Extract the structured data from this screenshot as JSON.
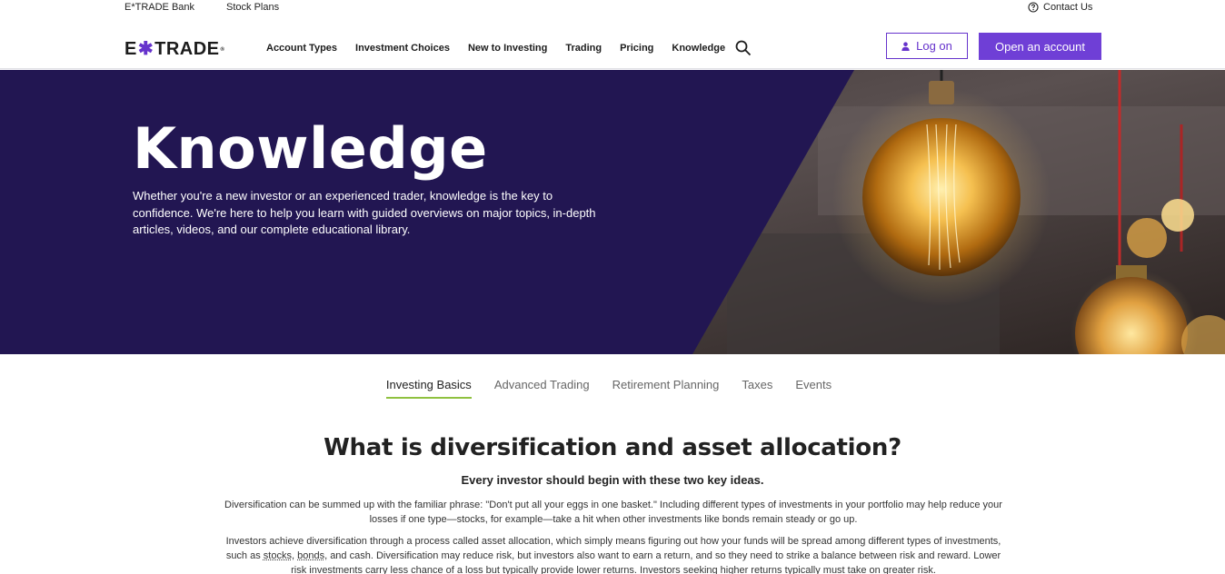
{
  "utility": {
    "bank": "E*TRADE Bank",
    "stock_plans": "Stock Plans",
    "contact": "Contact Us"
  },
  "brand": {
    "logo_pre": "E",
    "logo_star": "✱",
    "logo_post": "TRADE",
    "accent": "#6633cc"
  },
  "nav": {
    "items": [
      "Account Types",
      "Investment Choices",
      "New to Investing",
      "Trading",
      "Pricing",
      "Knowledge"
    ],
    "login_label": "Log on",
    "open_label": "Open an account"
  },
  "hero": {
    "title": "Knowledge",
    "description": "Whether you're a new investor or an experienced trader, knowledge is the key to confidence. We're here to help you learn with guided overviews on major topics, in-depth articles, videos, and our complete educational library."
  },
  "tabs": [
    "Investing Basics",
    "Advanced Trading",
    "Retirement Planning",
    "Taxes",
    "Events"
  ],
  "article": {
    "title": "What is diversification and asset allocation?",
    "subtitle": "Every investor should begin with these two key ideas.",
    "para1": "Diversification can be summed up with the familiar phrase: \"Don't put all your eggs in one basket.\" Including different types of investments in your portfolio may help reduce your losses if one type—stocks, for example—take a hit when other investments like bonds remain steady or go up.",
    "para2_a": "Investors achieve diversification through a process called asset allocation, which simply means figuring out how your funds will be spread among different types of investments, such as ",
    "para2_link1": "stocks",
    "para2_sep": ", ",
    "para2_link2": "bonds",
    "para2_b": ", and cash. Diversification may reduce risk, but investors also want to earn a return, and so they need to strike a balance between risk and reward. Lower risk investments carry less chance of a loss but typically provide lower returns. Investors seeking higher returns typically must take on greater risk."
  }
}
